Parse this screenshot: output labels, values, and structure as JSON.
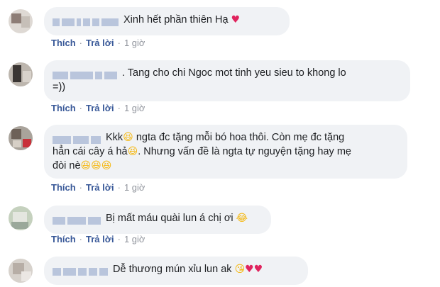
{
  "actions": {
    "like_label": "Thích",
    "reply_label": "Trả lời",
    "separator": "·"
  },
  "comments": [
    {
      "lines": [
        "Xinh hết phần thiên Hạ"
      ],
      "emoji_end": [
        "heart"
      ],
      "time": "1 giờ"
    },
    {
      "lines": [
        ". Tang cho chi Ngoc mot tinh yeu sieu to khong lo",
        "=))"
      ],
      "emoji_end": [],
      "time": "1 giờ"
    },
    {
      "lines": [
        "Kkk",
        "ngta đc tặng mỗi bó hoa thôi. Còn mẹ đc tặng",
        "hẳn cái cây á hả",
        ". Nhưng vấn đề là ngta tự nguyện tặng hay mẹ",
        "đòi nè"
      ],
      "emoji_end": [
        "laughing",
        "laughing",
        "laughing"
      ],
      "time": "1 giờ"
    },
    {
      "lines": [
        "Bị mất máu quài lun á chị ơi"
      ],
      "emoji_end": [
        "rofl"
      ],
      "time": "1 giờ"
    },
    {
      "lines": [
        "Dễ thương mún xỉu lun ak"
      ],
      "emoji_end": [
        "kissing",
        "heart",
        "heart"
      ],
      "time": ""
    }
  ],
  "colors": {
    "bubble": "#f0f2f5",
    "link": "#385898",
    "meta": "#90949c",
    "heart": "#e0245e",
    "emoji": "#f5b70d"
  }
}
